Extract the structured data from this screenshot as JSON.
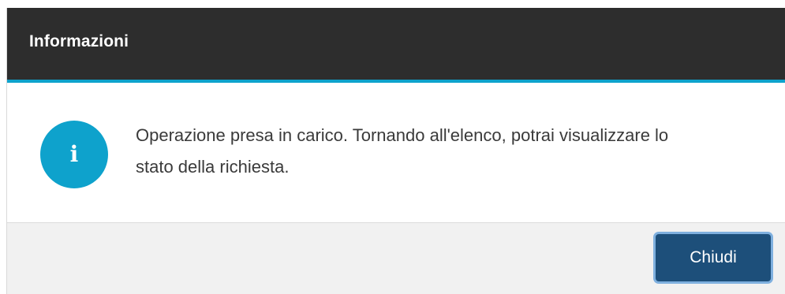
{
  "dialog": {
    "title": "Informazioni",
    "icon": "info-icon",
    "icon_glyph": "i",
    "message": "Operazione presa in carico. Tornando all'elenco, potrai visualizzare lo stato della richiesta.",
    "close_label": "Chiudi"
  },
  "colors": {
    "header_bg": "#2d2d2d",
    "accent": "#0ea2cc",
    "button_bg": "#1d4f7a",
    "footer_bg": "#f1f1f1"
  }
}
